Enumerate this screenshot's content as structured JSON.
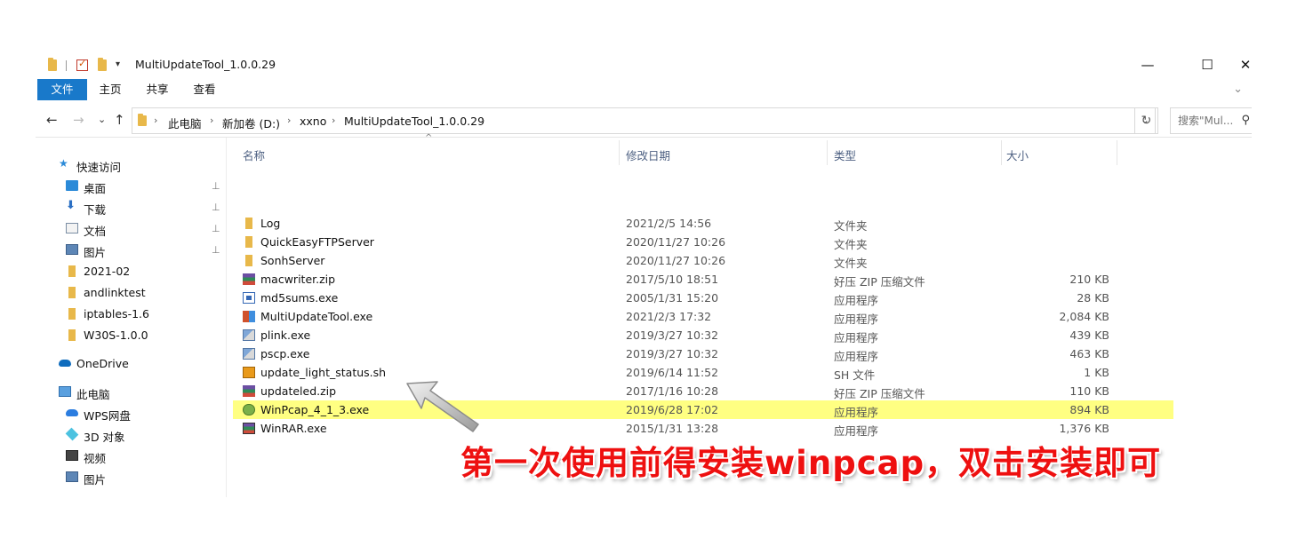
{
  "window": {
    "title": "MultiUpdateTool_1.0.0.29",
    "minimize": "—",
    "maximize": "☐",
    "close": "✕"
  },
  "ribbon": {
    "tabs": [
      {
        "label": "文件",
        "active": true
      },
      {
        "label": "主页",
        "active": false
      },
      {
        "label": "共享",
        "active": false
      },
      {
        "label": "查看",
        "active": false
      }
    ],
    "toggle": "⌄"
  },
  "address": {
    "crumbs": [
      "此电脑",
      "新加卷 (D:)",
      "xxno",
      "MultiUpdateTool_1.0.0.29"
    ],
    "separator": "›",
    "search_placeholder": "搜索\"Mul...",
    "refresh": "↻",
    "dropdown": "⌄"
  },
  "nav_buttons": {
    "back": "←",
    "forward": "→",
    "recent": "⌄",
    "up": "↑"
  },
  "nav_pane": {
    "quick_access": "快速访问",
    "pinned": [
      {
        "label": "桌面",
        "icon": "desktop-icon"
      },
      {
        "label": "下载",
        "icon": "download-icon"
      },
      {
        "label": "文档",
        "icon": "document-icon"
      },
      {
        "label": "图片",
        "icon": "picture-icon"
      }
    ],
    "folders": [
      "2021-02",
      "andlinktest",
      "iptables-1.6",
      "W30S-1.0.0"
    ],
    "onedrive": "OneDrive",
    "this_pc": "此电脑",
    "pc_items": [
      {
        "label": "WPS网盘",
        "icon": "wps-cloud-icon"
      },
      {
        "label": "3D 对象",
        "icon": "3d-objects-icon"
      },
      {
        "label": "视频",
        "icon": "video-icon"
      },
      {
        "label": "图片",
        "icon": "picture-icon"
      }
    ],
    "pin_glyph": "📌"
  },
  "columns": {
    "name": "名称",
    "date": "修改日期",
    "type": "类型",
    "size": "大小",
    "sort_arrow": "^"
  },
  "files": [
    {
      "name": "Log",
      "date": "2021/2/5 14:56",
      "type": "文件夹",
      "size": "",
      "icon": "folder"
    },
    {
      "name": "QuickEasyFTPServer",
      "date": "2020/11/27 10:26",
      "type": "文件夹",
      "size": "",
      "icon": "folder"
    },
    {
      "name": "SonhServer",
      "date": "2020/11/27 10:26",
      "type": "文件夹",
      "size": "",
      "icon": "folder"
    },
    {
      "name": "macwriter.zip",
      "date": "2017/5/10 18:51",
      "type": "好压 ZIP 压缩文件",
      "size": "210 KB",
      "icon": "zip"
    },
    {
      "name": "md5sums.exe",
      "date": "2005/1/31 15:20",
      "type": "应用程序",
      "size": "28 KB",
      "icon": "md5"
    },
    {
      "name": "MultiUpdateTool.exe",
      "date": "2021/2/3 17:32",
      "type": "应用程序",
      "size": "2,084 KB",
      "icon": "exe1"
    },
    {
      "name": "plink.exe",
      "date": "2019/3/27 10:32",
      "type": "应用程序",
      "size": "439 KB",
      "icon": "putty"
    },
    {
      "name": "pscp.exe",
      "date": "2019/3/27 10:32",
      "type": "应用程序",
      "size": "463 KB",
      "icon": "putty"
    },
    {
      "name": "update_light_status.sh",
      "date": "2019/6/14 11:52",
      "type": "SH 文件",
      "size": "1 KB",
      "icon": "sh"
    },
    {
      "name": "updateled.zip",
      "date": "2017/1/16 10:28",
      "type": "好压 ZIP 压缩文件",
      "size": "110 KB",
      "icon": "zip"
    },
    {
      "name": "WinPcap_4_1_3.exe",
      "date": "2019/6/28 17:02",
      "type": "应用程序",
      "size": "894 KB",
      "icon": "winpcap",
      "selected": true
    },
    {
      "name": "WinRAR.exe",
      "date": "2015/1/31 13:28",
      "type": "应用程序",
      "size": "1,376 KB",
      "icon": "winrar"
    }
  ],
  "annotation": {
    "text": "第一次使用前得安装winpcap，双击安装即可",
    "color": "#ee1010"
  },
  "colors": {
    "accent": "#1979ca",
    "highlight": "#ffff82",
    "folder": "#e8b84a"
  }
}
